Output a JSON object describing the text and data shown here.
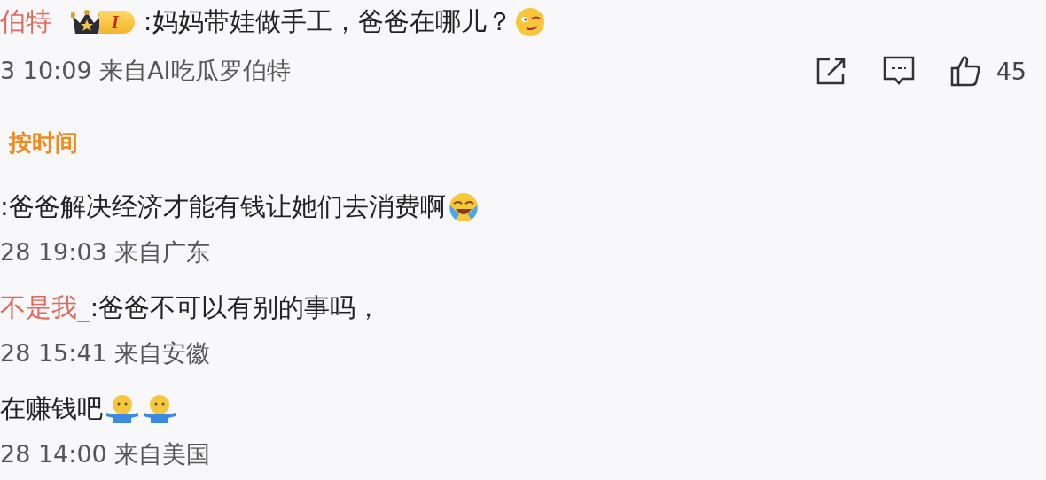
{
  "post": {
    "author": "伯特",
    "badge": "I",
    "text": ":妈妈带娃做手工，爸爸在哪儿？",
    "emojis": [
      {
        "kind": "smirk"
      }
    ],
    "meta": "3 10:09 来自AI吃瓜罗伯特",
    "like_count": "45"
  },
  "sort_label": "按时间",
  "replies": [
    {
      "text": ":爸爸解决经济才能有钱让她们去消费啊",
      "emojis": [
        {
          "kind": "laugh-cry"
        }
      ],
      "meta": "28 19:03 来自广东"
    },
    {
      "author": "不是我_",
      "text": ":爸爸不可以有别的事吗，",
      "meta": "28 15:41 来自安徽"
    },
    {
      "text": "在赚钱吧",
      "emojis": [
        {
          "kind": "shrug"
        },
        {
          "kind": "shrug"
        }
      ],
      "meta": "28 14:00 来自美国"
    }
  ]
}
